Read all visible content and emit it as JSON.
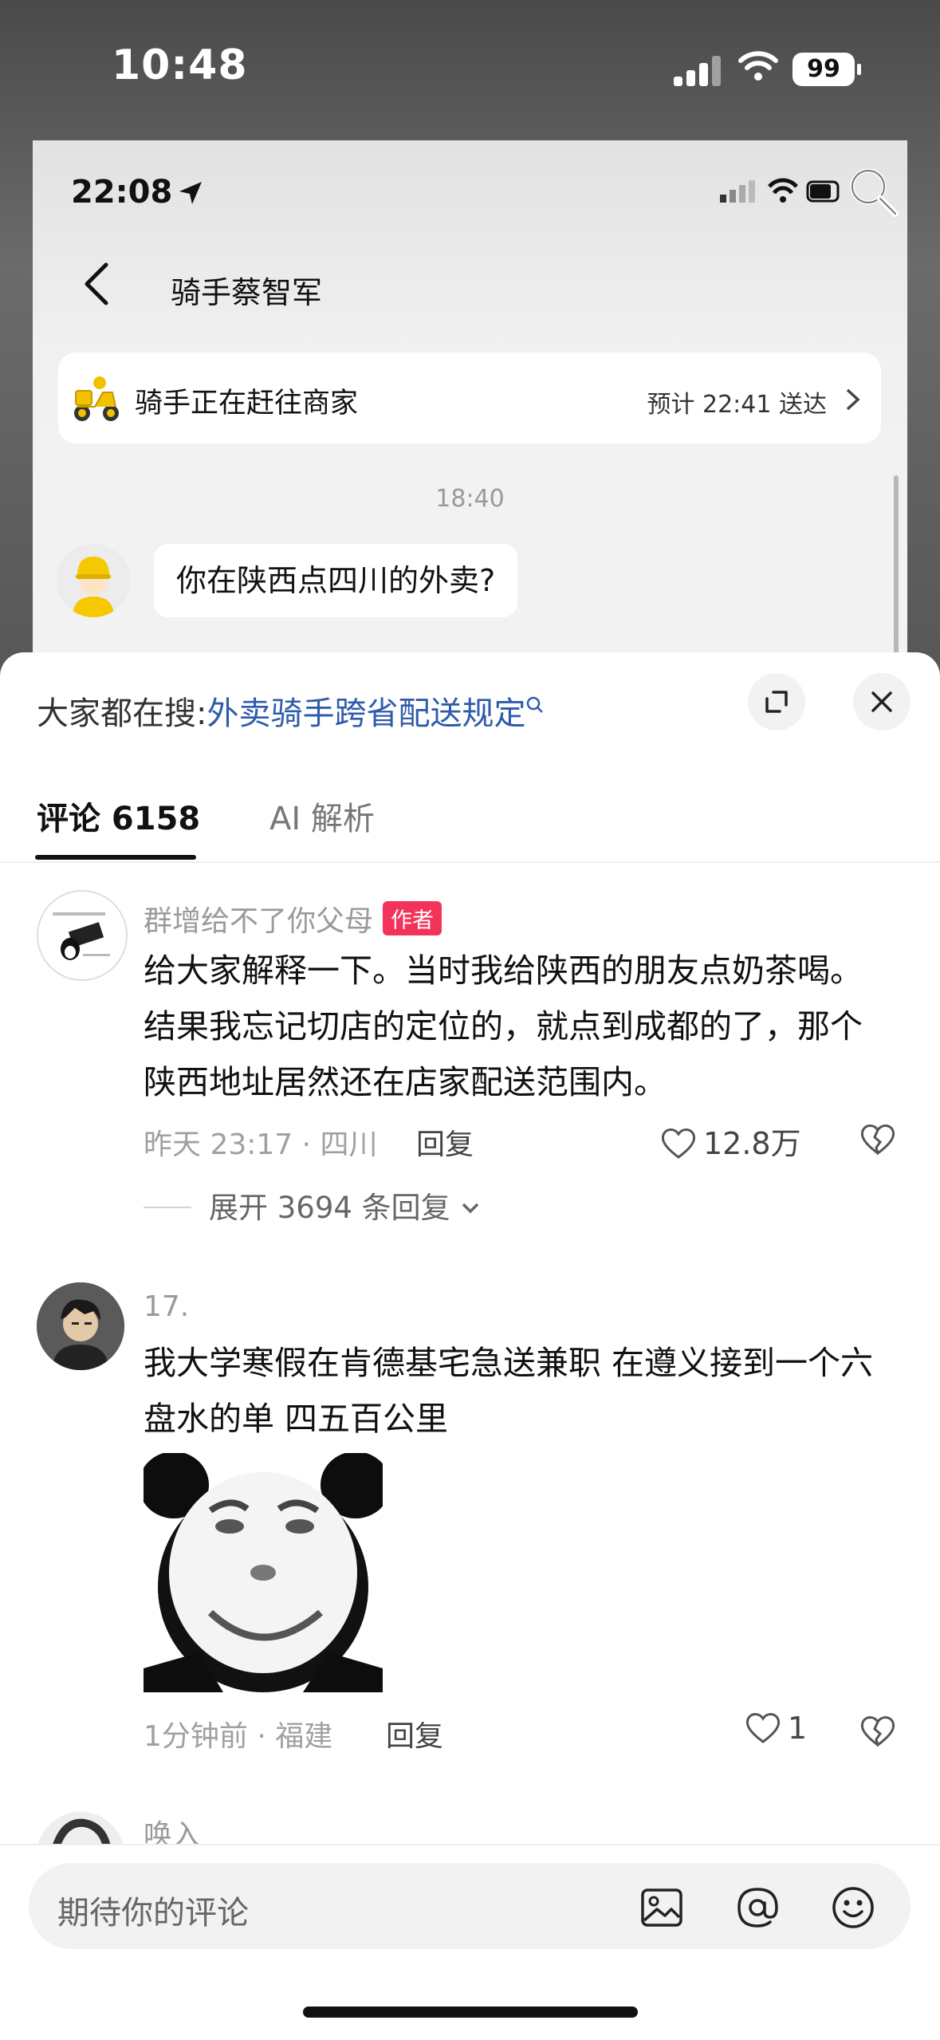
{
  "status_bar": {
    "time": "10:48",
    "battery": "99"
  },
  "inner_screen": {
    "time": "22:08",
    "chat_title": "骑手蔡智军",
    "rider_status": "骑手正在赶往商家",
    "eta": "预计 22:41 送达",
    "chat_timestamp": "18:40",
    "message": "你在陕西点四川的外卖?"
  },
  "sheet": {
    "search_prefix": "大家都在搜:",
    "search_link": "外卖骑手跨省配送规定",
    "tabs": [
      {
        "label": "评论 6158",
        "active": true
      },
      {
        "label": "AI 解析",
        "active": false
      }
    ]
  },
  "comments": [
    {
      "username": "群增给不了你父母",
      "badge": "作者",
      "text": "给大家解释一下。当时我给陕西的朋友点奶茶喝。结果我忘记切店的定位的，就点到成都的了，那个陕西地址居然还在店家配送范围内。",
      "meta": "昨天 23:17 · 四川",
      "reply_label": "回复",
      "likes": "12.8万",
      "expand_label": "展开 3694 条回复"
    },
    {
      "username": "17.",
      "text": "我大学寒假在肯德基宅急送兼职 在遵义接到一个六盘水的单 四五百公里",
      "meta": "1分钟前 · 福建",
      "reply_label": "回复",
      "likes": "1"
    },
    {
      "username": "唤入"
    }
  ],
  "input": {
    "placeholder": "期待你的评论"
  },
  "icons": [
    "location-arrow-icon",
    "search-icon",
    "back-icon",
    "scooter-icon",
    "chevron-right-icon",
    "expand-icon",
    "close-icon",
    "heart-icon",
    "dislike-icon",
    "chevron-down-icon",
    "image-icon",
    "at-icon",
    "emoji-icon"
  ],
  "colors": {
    "author_badge": "#f2335a",
    "search_link": "#2e5cab"
  }
}
